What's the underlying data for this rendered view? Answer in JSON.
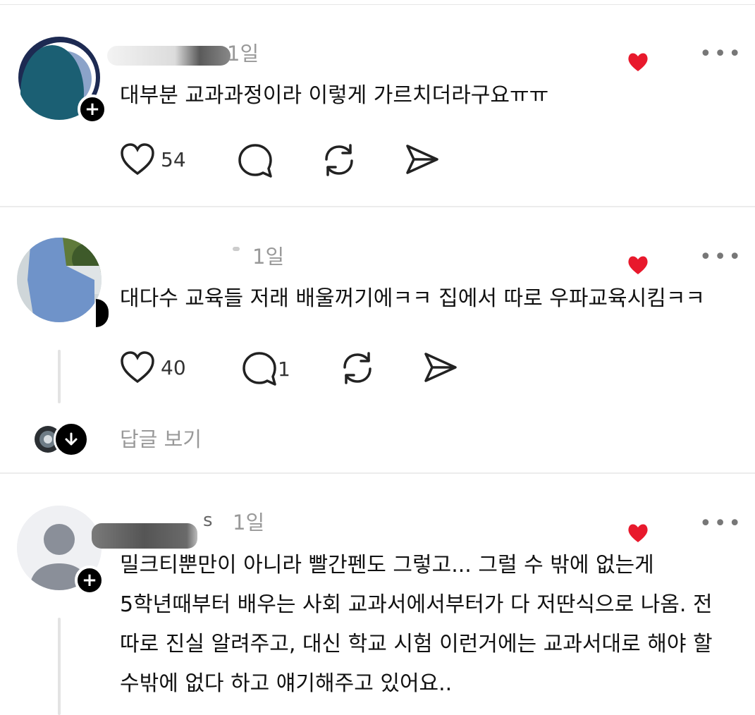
{
  "comments": [
    {
      "time": "1일",
      "text": "대부분 교과과정이라 이렇게 가르치더라구요ㅠㅠ",
      "likes": "54",
      "replies": ""
    },
    {
      "time": "1일",
      "text": "대다수 교육들 저래 배울꺼기에ㅋㅋ 집에서 따로 우파교육시킴ㅋㅋ",
      "likes": "40",
      "replies": "1",
      "view_replies": "답글 보기"
    },
    {
      "time": "1일",
      "name_fragment": "s",
      "text_lines": [
        "밀크티뿐만이 아니라 빨간펜도 그렇고... 그럴 수 밖에 없는게",
        "5학년때부터 배우는 사회 교과서에서부터가 다 저딴식으로 나옴. 전",
        "따로 진실 알려주고,  대신 학교 시험 이런거에는 교과서대로 해야 할",
        "수밖에 없다 하고 얘기해주고 있어요.."
      ]
    }
  ],
  "icons": {
    "more": "•••",
    "plus": "+"
  },
  "colors": {
    "reaction_heart": "#e8192c",
    "muted_text": "#999999"
  }
}
